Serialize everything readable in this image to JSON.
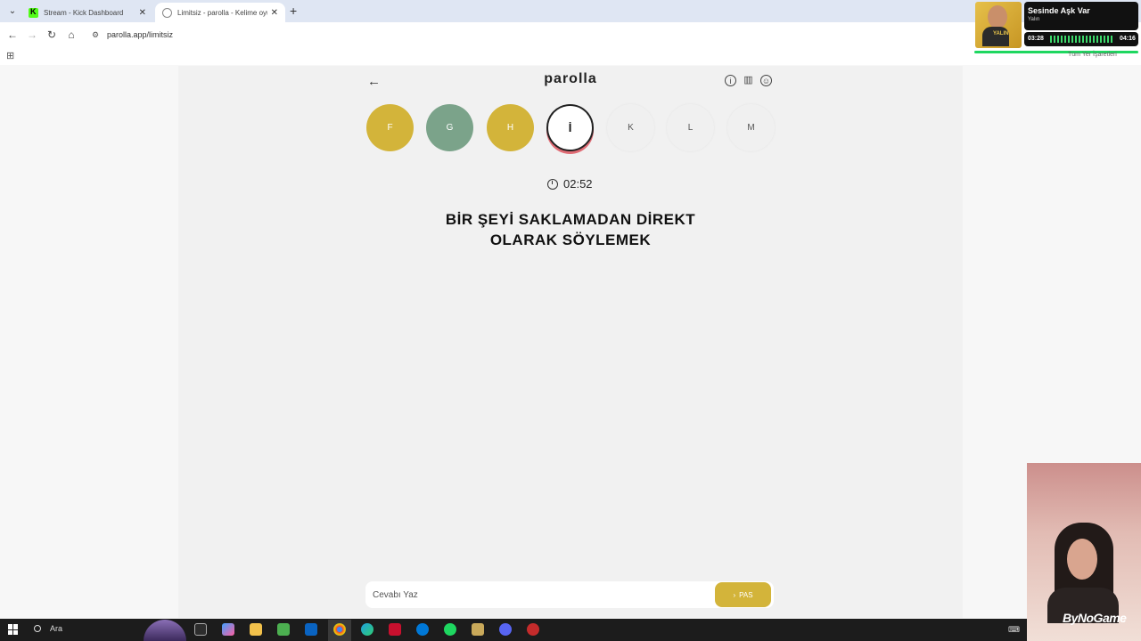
{
  "browser": {
    "tabs": [
      {
        "title": "Stream - Kick Dashboard",
        "active": false
      },
      {
        "title": "Limitsiz - parolla - Kelime oyunu",
        "active": true
      }
    ],
    "url": "parolla.app/limitsiz"
  },
  "game": {
    "brand": "parolla",
    "letters": [
      {
        "letter": "F",
        "state": "answered"
      },
      {
        "letter": "G",
        "state": "correct"
      },
      {
        "letter": "H",
        "state": "answered"
      },
      {
        "letter": "İ",
        "state": "active"
      },
      {
        "letter": "K",
        "state": "pending"
      },
      {
        "letter": "L",
        "state": "pending"
      },
      {
        "letter": "M",
        "state": "pending"
      }
    ],
    "timer": "02:52",
    "question_line1": "BİR ŞEYİ SAKLAMADAN DİREKT",
    "question_line2": "OLARAK SÖYLEMEK",
    "answer_placeholder": "Cevabı Yaz",
    "pass_label": "PAS"
  },
  "music": {
    "title": "Sesinde Aşk Var",
    "artist": "Yalın",
    "cover_text": "YALIN",
    "current_time": "03:28",
    "total_time": "04:16",
    "bookmarks_label": "Tüm Yer İşaretleri"
  },
  "overlay": {
    "brand_mark": "ByNoGame"
  },
  "taskbar": {
    "search_label": "Ara"
  },
  "colors": {
    "yellow": "#d3b43a",
    "green": "#7ba38a",
    "active_ring": "#e06c75"
  }
}
